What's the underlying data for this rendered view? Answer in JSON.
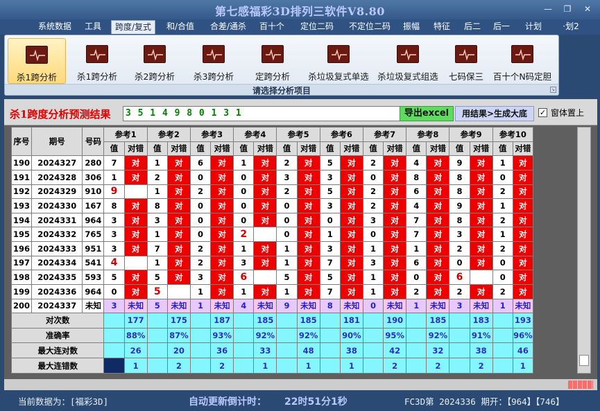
{
  "window": {
    "title": "第七感福彩3D排列三软件V8.80",
    "minimize": "—",
    "restore": "❐",
    "close": "✕"
  },
  "menu": [
    {
      "label": "系统数据",
      "name": "menu-system-data"
    },
    {
      "label": "工具",
      "name": "menu-tools"
    },
    {
      "label": "跨度/复式",
      "name": "menu-span-compound",
      "active": true
    },
    {
      "label": "和/合值",
      "name": "menu-sum-value"
    },
    {
      "label": "合差/通杀",
      "name": "menu-diff-kill"
    },
    {
      "label": "百十个",
      "name": "menu-digits"
    },
    {
      "label": "定位二码",
      "name": "menu-fixed-2code"
    },
    {
      "label": "不定位二码",
      "name": "menu-unfixed-2code"
    },
    {
      "label": "振幅",
      "name": "menu-amplitude"
    },
    {
      "label": "特征",
      "name": "menu-features"
    },
    {
      "label": "后二",
      "name": "menu-last-two"
    },
    {
      "label": "后一",
      "name": "menu-last-one"
    },
    {
      "label": "计划",
      "name": "menu-plan"
    },
    {
      "label": "·划2",
      "name": "menu-plan-2"
    }
  ],
  "ribbon": {
    "caption": "请选择分析项目",
    "buttons": [
      {
        "label": "杀1跨分析",
        "name": "ribbon-kill-span-1a",
        "active": true
      },
      {
        "label": "杀1跨分析",
        "name": "ribbon-kill-span-1b"
      },
      {
        "label": "杀2跨分析",
        "name": "ribbon-kill-span-2"
      },
      {
        "label": "杀3跨分析",
        "name": "ribbon-kill-span-3"
      },
      {
        "label": "定跨分析",
        "name": "ribbon-fixed-span"
      },
      {
        "label": "杀垃圾复式单选",
        "name": "ribbon-kill-garbage-single"
      },
      {
        "label": "杀垃圾复式组选",
        "name": "ribbon-kill-garbage-group"
      },
      {
        "label": "七码保三",
        "name": "ribbon-seven-code"
      },
      {
        "label": "百十个N码定胆",
        "name": "ribbon-n-code"
      }
    ]
  },
  "result": {
    "label": "杀1跨度分析预测结果",
    "value": "3 5 1 4 9 8 0 1 3 1",
    "export_label": "导出excel",
    "generate_label": "用结果>生成大底",
    "on_top_label": "窗体置上",
    "on_top_checked": "✓"
  },
  "table": {
    "headers": {
      "index": "序号",
      "issue": "期号",
      "number": "号码",
      "value": "值",
      "result": "对错"
    },
    "refs": [
      "参考1",
      "参考2",
      "参考3",
      "参考4",
      "参考5",
      "参考6",
      "参考7",
      "参考8",
      "参考9",
      "参考10"
    ],
    "hit_text": "对",
    "rows": [
      {
        "idx": "190",
        "issue": "2024327",
        "num": "280",
        "cells": [
          [
            "7",
            1
          ],
          [
            "1",
            1
          ],
          [
            "6",
            1
          ],
          [
            "1",
            1
          ],
          [
            "2",
            1
          ],
          [
            "5",
            1
          ],
          [
            "2",
            1
          ],
          [
            "4",
            1
          ],
          [
            "9",
            1
          ],
          [
            "1",
            1
          ]
        ]
      },
      {
        "idx": "191",
        "issue": "2024328",
        "num": "306",
        "cells": [
          [
            "1",
            1
          ],
          [
            "2",
            1
          ],
          [
            "0",
            1
          ],
          [
            "0",
            1
          ],
          [
            "3",
            1
          ],
          [
            "3",
            1
          ],
          [
            "0",
            1
          ],
          [
            "8",
            1
          ],
          [
            "8",
            1
          ],
          [
            "0",
            1
          ]
        ]
      },
      {
        "idx": "192",
        "issue": "2024329",
        "num": "910",
        "cells": [
          [
            "9",
            0
          ],
          [
            "1",
            1
          ],
          [
            "2",
            1
          ],
          [
            "0",
            1
          ],
          [
            "2",
            1
          ],
          [
            "5",
            1
          ],
          [
            "2",
            1
          ],
          [
            "6",
            1
          ],
          [
            "8",
            1
          ],
          [
            "2",
            1
          ]
        ]
      },
      {
        "idx": "193",
        "issue": "2024330",
        "num": "167",
        "cells": [
          [
            "8",
            1
          ],
          [
            "8",
            1
          ],
          [
            "0",
            1
          ],
          [
            "0",
            1
          ],
          [
            "0",
            1
          ],
          [
            "3",
            1
          ],
          [
            "2",
            1
          ],
          [
            "4",
            1
          ],
          [
            "9",
            1
          ],
          [
            "1",
            1
          ]
        ]
      },
      {
        "idx": "194",
        "issue": "2024331",
        "num": "964",
        "cells": [
          [
            "3",
            1
          ],
          [
            "3",
            1
          ],
          [
            "0",
            1
          ],
          [
            "0",
            1
          ],
          [
            "0",
            1
          ],
          [
            "0",
            1
          ],
          [
            "3",
            1
          ],
          [
            "7",
            1
          ],
          [
            "8",
            1
          ],
          [
            "2",
            1
          ]
        ]
      },
      {
        "idx": "195",
        "issue": "2024332",
        "num": "765",
        "cells": [
          [
            "3",
            1
          ],
          [
            "1",
            1
          ],
          [
            "0",
            1
          ],
          [
            "2",
            0
          ],
          [
            "0",
            1
          ],
          [
            "1",
            1
          ],
          [
            "0",
            1
          ],
          [
            "7",
            1
          ],
          [
            "3",
            1
          ],
          [
            "1",
            1
          ]
        ]
      },
      {
        "idx": "196",
        "issue": "2024333",
        "num": "951",
        "cells": [
          [
            "3",
            1
          ],
          [
            "7",
            1
          ],
          [
            "2",
            1
          ],
          [
            "1",
            1
          ],
          [
            "1",
            1
          ],
          [
            "3",
            1
          ],
          [
            "1",
            1
          ],
          [
            "1",
            1
          ],
          [
            "2",
            1
          ],
          [
            "2",
            1
          ]
        ]
      },
      {
        "idx": "197",
        "issue": "2024334",
        "num": "541",
        "cells": [
          [
            "4",
            0
          ],
          [
            "1",
            1
          ],
          [
            "2",
            1
          ],
          [
            "3",
            1
          ],
          [
            "1",
            1
          ],
          [
            "7",
            1
          ],
          [
            "3",
            1
          ],
          [
            "6",
            1
          ],
          [
            "0",
            1
          ],
          [
            "0",
            1
          ]
        ]
      },
      {
        "idx": "198",
        "issue": "2024335",
        "num": "593",
        "cells": [
          [
            "5",
            1
          ],
          [
            "5",
            1
          ],
          [
            "3",
            1
          ],
          [
            "6",
            0
          ],
          [
            "5",
            1
          ],
          [
            "5",
            1
          ],
          [
            "1",
            1
          ],
          [
            "0",
            1
          ],
          [
            "6",
            0
          ],
          [
            "0",
            1
          ]
        ]
      },
      {
        "idx": "199",
        "issue": "2024336",
        "num": "964",
        "cells": [
          [
            "0",
            1
          ],
          [
            "5",
            0
          ],
          [
            "1",
            1
          ],
          [
            "1",
            1
          ],
          [
            "1",
            1
          ],
          [
            "7",
            1
          ],
          [
            "1",
            1
          ],
          [
            "2",
            1
          ],
          [
            "2",
            1
          ],
          [
            "2",
            1
          ]
        ]
      }
    ],
    "prediction": {
      "idx": "200",
      "issue": "2024337",
      "num": "未知",
      "values": [
        "3",
        "5",
        "1",
        "4",
        "9",
        "8",
        "0",
        "1",
        "3",
        "1"
      ],
      "unknown_text": "未知"
    },
    "stats": [
      {
        "label": "对次数",
        "values": [
          "177",
          "175",
          "187",
          "185",
          "185",
          "181",
          "190",
          "185",
          "183",
          "193"
        ]
      },
      {
        "label": "准确率",
        "values": [
          "88%",
          "87%",
          "93%",
          "92%",
          "92%",
          "90%",
          "95%",
          "92%",
          "91%",
          "96%"
        ]
      },
      {
        "label": "最大连对数",
        "values": [
          "26",
          "20",
          "36",
          "33",
          "48",
          "38",
          "42",
          "32",
          "38",
          "46"
        ]
      },
      {
        "label": "最大连错数",
        "values": [
          "1",
          "2",
          "2",
          "1",
          "1",
          "1",
          "2",
          "2",
          "2",
          "1"
        ]
      }
    ]
  },
  "status": {
    "source": "当前数据为：[福彩3D]",
    "countdown_label": "自动更新倒计时：",
    "countdown_value": "22时51分1秒",
    "issue_info": "FC3D第 2024336 期开：【964】【746】"
  }
}
